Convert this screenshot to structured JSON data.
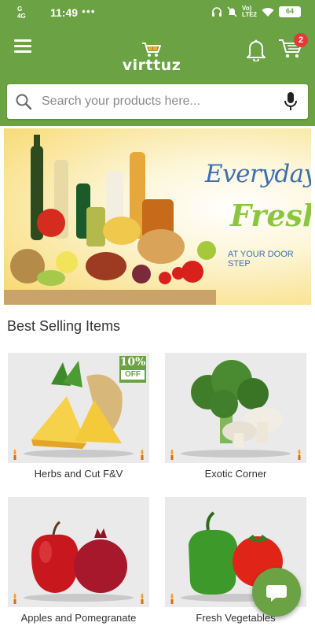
{
  "status_bar": {
    "network_top": "G",
    "network_bottom": "4G",
    "time": "11:49",
    "dots": "•••",
    "volte_top": "Vo)",
    "volte_bottom": "LTE2",
    "battery": "64"
  },
  "app_bar": {
    "logo_text": "virttuz",
    "cart_count": "2",
    "icons": [
      "menu-icon",
      "bell-icon",
      "cart-icon"
    ]
  },
  "search": {
    "placeholder": "Search your products here..."
  },
  "banner": {
    "line1": "Everyday",
    "line2": "Fresh,",
    "line3": "AT YOUR DOOR STEP"
  },
  "section": {
    "title": "Best Selling Items"
  },
  "products": [
    {
      "label": "Herbs and Cut F&V",
      "offer_pct": "10%",
      "offer_text": "OFF"
    },
    {
      "label": "Exotic Corner"
    },
    {
      "label": "Apples and Pomegranate"
    },
    {
      "label": "Fresh Vegetables"
    }
  ],
  "colors": {
    "brand_green": "#6aa244",
    "badge_red": "#e53935"
  }
}
